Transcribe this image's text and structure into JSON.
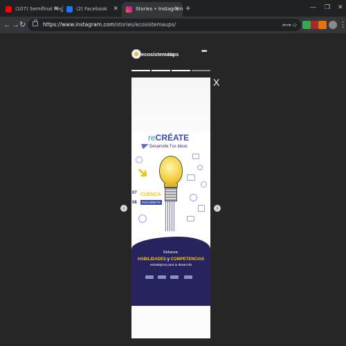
{
  "browser": {
    "tabs": [
      {
        "title": "(107) Semifinal Regional San Fr...",
        "favicon_color": "#ff0000",
        "active": false
      },
      {
        "title": "(2) Facebook",
        "favicon_color": "#1877f2",
        "active": false
      },
      {
        "title": "Stories • Instagram",
        "favicon_color": "#d6249f",
        "active": true
      }
    ],
    "new_tab": "+",
    "window_controls": {
      "minimize": "—",
      "maximize": "❐",
      "close": "✕"
    },
    "nav": {
      "back": "←",
      "forward": "→",
      "reload": "↻"
    },
    "url": {
      "domain": "https://www.instagram.com",
      "path": "/stories/ecosistemaups/"
    },
    "menu": "⋮"
  },
  "story": {
    "username": "ecosistemaups",
    "time": "1h",
    "more": "•••",
    "segments": 4,
    "active_segment": 3,
    "close": "X",
    "prev": "‹",
    "next": "›"
  },
  "poster": {
    "title_prefix": "re",
    "title_main": "CRÉATE",
    "subtitle": "Desarrolla Tus Ideas",
    "date1": "07",
    "date2": "08",
    "city": "CUENCA",
    "cta": "INSCRÍBETE",
    "tagline": "Refuerza:",
    "skills_a": "HABILIDADES",
    "skills_join": " y ",
    "skills_b": "COMPETENCIAS",
    "strategic": "estratégicas para tu desarrollo"
  },
  "colors": {
    "accent_blue": "#3b4aa8",
    "yellow": "#f0c419",
    "navy": "#26235f"
  }
}
